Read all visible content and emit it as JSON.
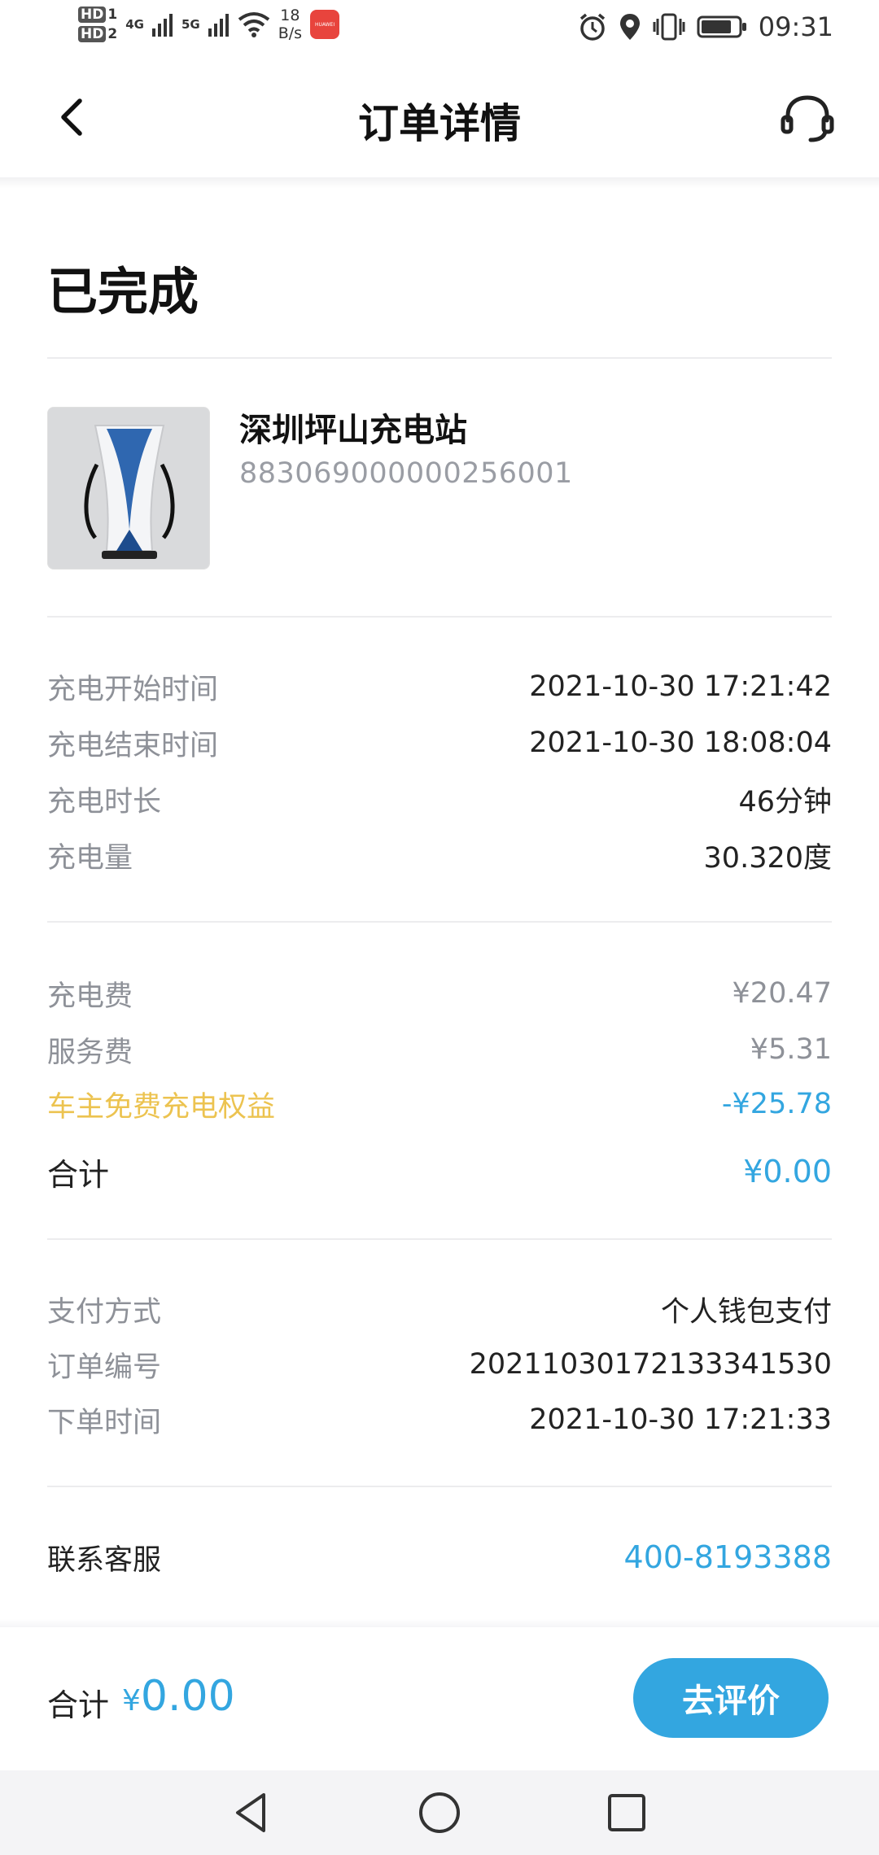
{
  "status_bar": {
    "sim1": "HD",
    "sim1_num": "1",
    "sim2": "HD",
    "sim2_num": "2",
    "net1": "4G",
    "net2": "5G",
    "speed_value": "18",
    "speed_unit": "B/s",
    "app_icon_text": "HUAWEI",
    "time": "09:31",
    "icons": [
      "alarm-icon",
      "location-icon",
      "vibrate-icon",
      "battery-icon"
    ]
  },
  "header": {
    "title": "订单详情",
    "back_icon": "chevron-left-icon",
    "support_icon": "headset-icon"
  },
  "order_status": "已完成",
  "station": {
    "name": "深圳坪山充电站",
    "id": "883069000000256001"
  },
  "charging": [
    {
      "label": "充电开始时间",
      "value": "2021-10-30 17:21:42"
    },
    {
      "label": "充电结束时间",
      "value": "2021-10-30 18:08:04"
    },
    {
      "label": "充电时长",
      "value": "46分钟"
    },
    {
      "label": "充电量",
      "value": "30.320度"
    }
  ],
  "fees": {
    "charge_fee": {
      "label": "充电费",
      "value": "¥20.47"
    },
    "service_fee": {
      "label": "服务费",
      "value": "¥5.31"
    },
    "benefit": {
      "label": "车主免费充电权益",
      "value": "-¥25.78"
    },
    "total": {
      "label": "合计",
      "value": "¥0.00"
    }
  },
  "payment": [
    {
      "label": "支付方式",
      "value": "个人钱包支付"
    },
    {
      "label": "订单编号",
      "value": "20211030172133341530"
    },
    {
      "label": "下单时间",
      "value": "2021-10-30 17:21:33"
    }
  ],
  "contact": {
    "label": "联系客服",
    "value": "400-8193388"
  },
  "bottom": {
    "total_label": "合计",
    "currency": "¥",
    "amount": "0.00",
    "review_button": "去评价"
  },
  "colors": {
    "accent": "#33a6e0",
    "benefit": "#ecc350",
    "label_grey": "#8e9198"
  }
}
